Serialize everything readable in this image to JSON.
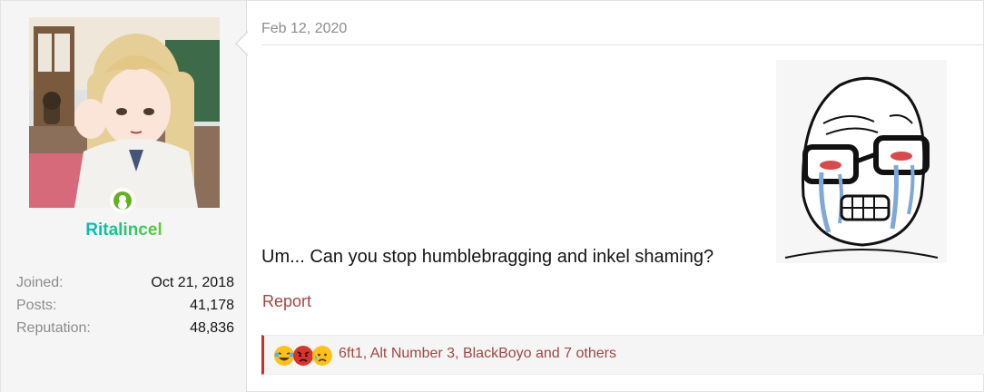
{
  "user": {
    "avatar_icon": "anime-girl-avatar",
    "online_icon": "online-status-icon",
    "username": "Ritalincel",
    "stats": [
      {
        "label": "Joined:",
        "value": "Oct 21, 2018"
      },
      {
        "label": "Posts:",
        "value": "41,178"
      },
      {
        "label": "Reputation:",
        "value": "48,836"
      }
    ]
  },
  "post": {
    "date": "Feb 12, 2020",
    "message": "Um... Can you stop humblebragging and inkel shaming?",
    "meme_icon": "crying-wojak-image",
    "report_label": "Report"
  },
  "reactions": {
    "icons": [
      "laughing-crying-emoji-icon",
      "angry-emoji-icon",
      "sad-emoji-icon"
    ],
    "summary": "6ft1, Alt Number 3, BlackBoyo and 7 others"
  },
  "colors": {
    "link": "#a04742",
    "accent_border": "#c9302c",
    "online": "#63b11c"
  }
}
